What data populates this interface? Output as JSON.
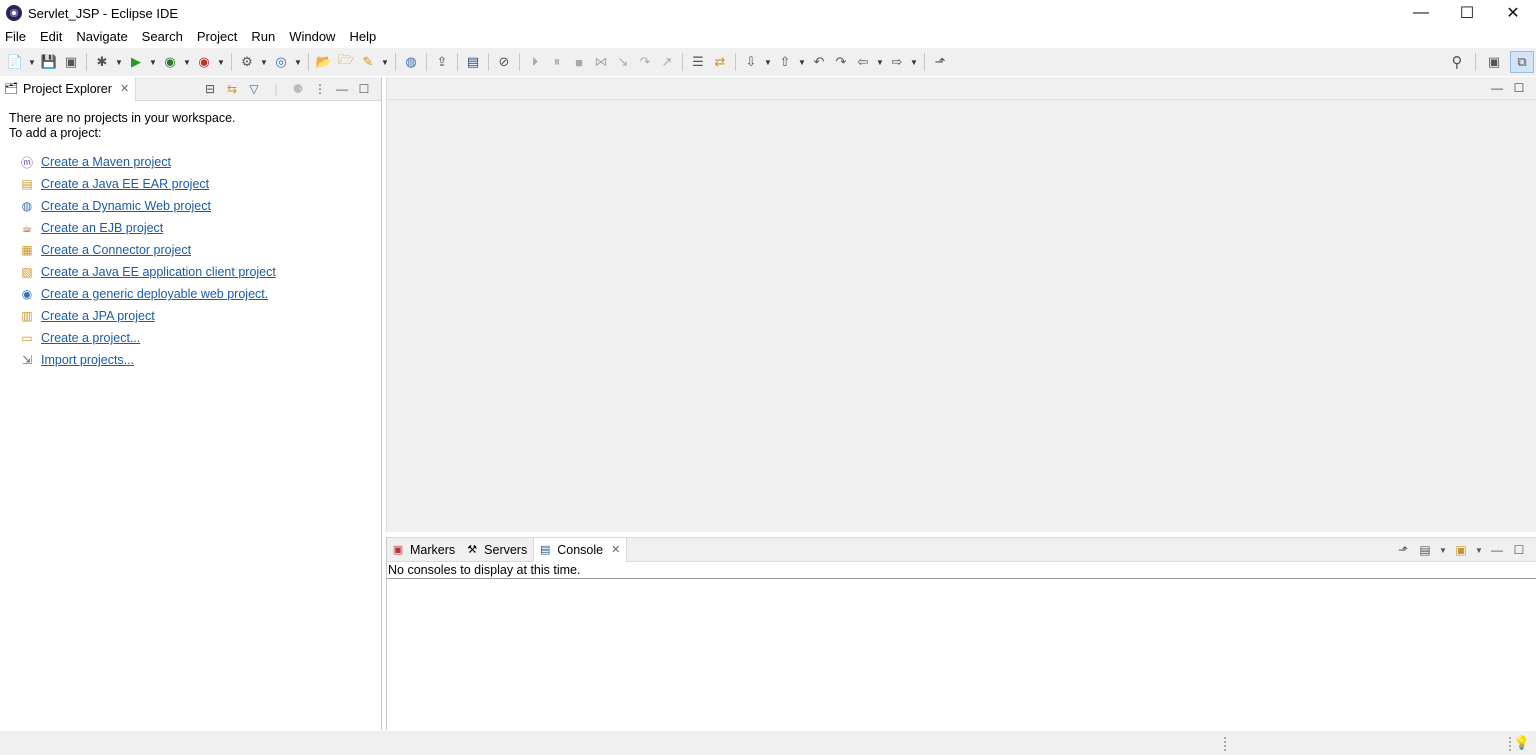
{
  "window": {
    "title": "Servlet_JSP - Eclipse IDE",
    "minimize": "—",
    "maximize": "☐",
    "close": "✕"
  },
  "menu": [
    "File",
    "Edit",
    "Navigate",
    "Search",
    "Project",
    "Run",
    "Window",
    "Help"
  ],
  "toolbar_icons": [
    "new-wizard-icon",
    "save-icon",
    "save-all-icon",
    "debug-icon",
    "run-icon",
    "coverage-icon",
    "external-tools-icon",
    "new-server-icon",
    "new-web-icon",
    "open-type-icon",
    "open-resource-icon",
    "search-icon",
    "globe-icon",
    "deploy-icon",
    "terminal-icon",
    "skip-breakpoints-icon",
    "resume-icon",
    "suspend-icon",
    "terminate-icon",
    "disconnect-icon",
    "step-into-icon",
    "step-over-icon",
    "step-return-icon",
    "annotation-next-icon",
    "annotation-prev-icon",
    "back-icon",
    "forward-icon",
    "pin-editor-icon"
  ],
  "project_explorer": {
    "tab_title": "Project Explorer",
    "empty_line1": "There are no projects in your workspace.",
    "empty_line2": "To add a project:",
    "links": [
      {
        "label": "Create a Maven project",
        "icon": "maven-icon"
      },
      {
        "label": "Create a Java EE EAR project",
        "icon": "ear-project-icon"
      },
      {
        "label": "Create a Dynamic Web project",
        "icon": "web-project-icon"
      },
      {
        "label": "Create an EJB project",
        "icon": "ejb-project-icon"
      },
      {
        "label": "Create a Connector project",
        "icon": "connector-project-icon"
      },
      {
        "label": "Create a Java EE application client project",
        "icon": "app-client-icon"
      },
      {
        "label": "Create a generic deployable web project.",
        "icon": "deployable-web-icon"
      },
      {
        "label": "Create a JPA project",
        "icon": "jpa-project-icon"
      },
      {
        "label": "Create a project...",
        "icon": "new-project-icon"
      },
      {
        "label": "Import projects...",
        "icon": "import-icon"
      }
    ]
  },
  "bottom": {
    "tabs": [
      {
        "label": "Markers",
        "icon": "markers-icon"
      },
      {
        "label": "Servers",
        "icon": "servers-icon"
      },
      {
        "label": "Console",
        "icon": "console-icon"
      }
    ],
    "console_message": "No consoles to display at this time."
  },
  "colors": {
    "link": "#1a5ca8",
    "chrome": "#f0f0f0",
    "perspective_active": "#d4e4f7"
  }
}
